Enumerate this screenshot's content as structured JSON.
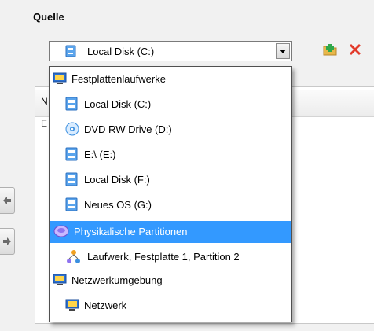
{
  "group_label": "Quelle",
  "combo": {
    "selected_label": "Local Disk (C:)",
    "selected_icon": "drive-icon"
  },
  "background": {
    "header_text": "N",
    "item_text": "E"
  },
  "toolbar": {
    "add_icon": "folder-add-icon",
    "delete_icon": "delete-icon"
  },
  "nav": {
    "left_icon": "arrow-left-icon",
    "right_icon": "arrow-right-icon"
  },
  "dropdown": {
    "items": [
      {
        "label": "Festplattenlaufwerke",
        "icon": "computer-icon",
        "level": 0
      },
      {
        "label": "Local Disk (C:)",
        "icon": "drive-icon",
        "level": 1
      },
      {
        "label": "DVD RW Drive (D:)",
        "icon": "dvd-icon",
        "level": 1
      },
      {
        "label": "E:\\ (E:)",
        "icon": "drive-icon",
        "level": 1
      },
      {
        "label": "Local Disk (F:)",
        "icon": "drive-icon",
        "level": 1
      },
      {
        "label": "Neues OS (G:)",
        "icon": "drive-icon",
        "level": 1
      },
      {
        "label": "Physikalische Partitionen",
        "icon": "partition-icon",
        "level": 0,
        "selected": true
      },
      {
        "label": "Laufwerk, Festplatte 1, Partition 2",
        "icon": "partition-tree-icon",
        "level": 1
      },
      {
        "label": "Netzwerkumgebung",
        "icon": "computer-icon",
        "level": 0
      },
      {
        "label": "Netzwerk",
        "icon": "computer-icon",
        "level": 1
      }
    ]
  },
  "colors": {
    "selection": "#3399ff",
    "drive_blue": "#3b8fe0",
    "delete_red": "#e23a2a"
  }
}
